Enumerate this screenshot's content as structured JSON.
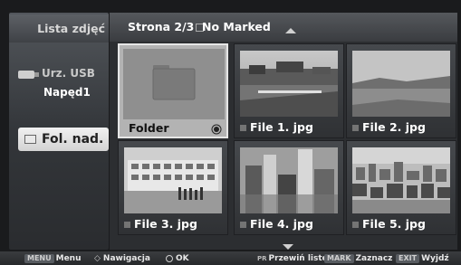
{
  "left_panel": {
    "title": "Lista zdjęć",
    "usb_label": "Urz. USB",
    "drive_label": "Napęd1",
    "folder_up_label": "Fol. nad."
  },
  "header": {
    "page_text": "Strona 2/3",
    "marked_text": "No Marked"
  },
  "tiles": [
    {
      "type": "folder",
      "label": "Folder",
      "selected": true
    },
    {
      "type": "image",
      "label": "File 1. jpg",
      "selected": false
    },
    {
      "type": "image",
      "label": "File 2. jpg",
      "selected": false
    },
    {
      "type": "image",
      "label": "File 3. jpg",
      "selected": false
    },
    {
      "type": "image",
      "label": "File 4. jpg",
      "selected": false
    },
    {
      "type": "image",
      "label": "File 5. jpg",
      "selected": false
    }
  ],
  "bottom_bar": {
    "menu_key": "MENU",
    "menu_label": "Menu",
    "nav_label": "Nawigacja",
    "ok_label": "OK",
    "pr_key": "PR",
    "scroll_label": "Przewiń listę",
    "mark_key": "MARK",
    "mark_label": "Zaznacz",
    "exit_key": "EXIT",
    "exit_label": "Wyjdź"
  },
  "colors": {
    "background": "#1c1d1f",
    "panel": "#3a3d41",
    "selected_tile": "#b3b3b3",
    "highlight_button": "#e6e6e6"
  }
}
